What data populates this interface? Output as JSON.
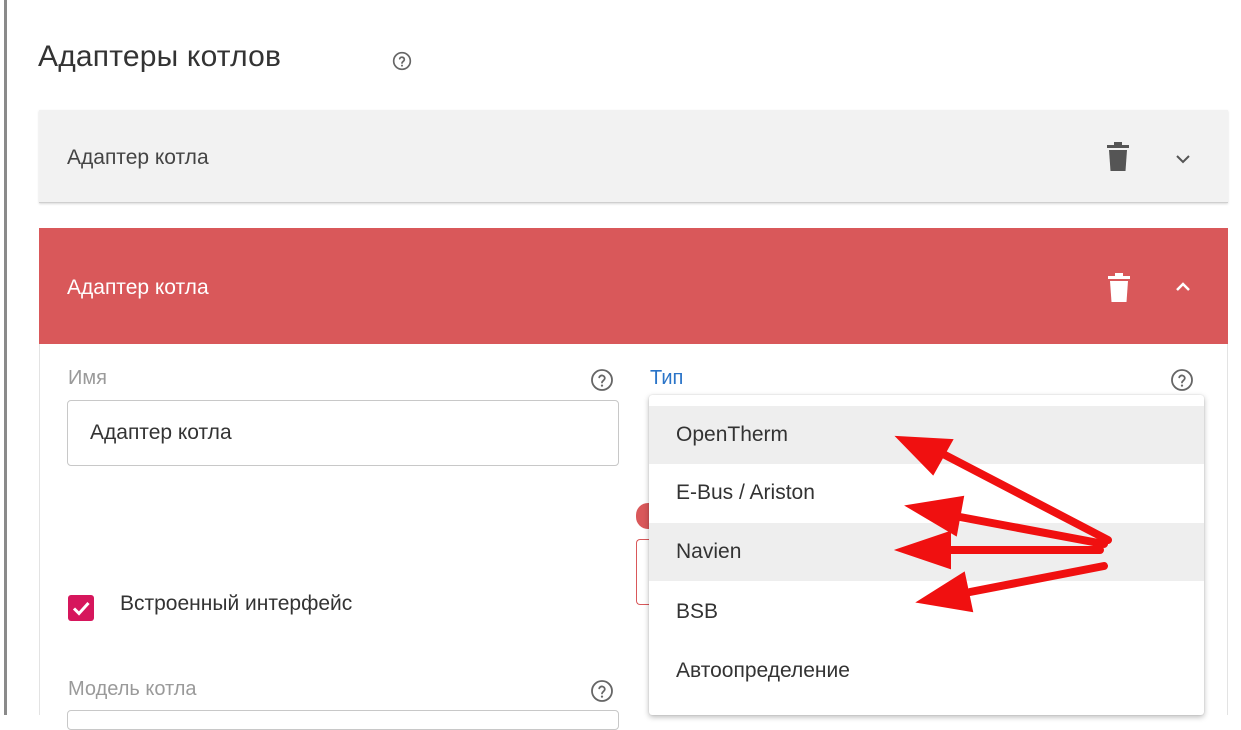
{
  "page": {
    "title": "Адаптеры котлов"
  },
  "adapters": [
    {
      "name": "Адаптер котла",
      "expanded": false
    },
    {
      "name": "Адаптер котла",
      "expanded": true
    }
  ],
  "form": {
    "name_label": "Имя",
    "name_value": "Адаптер котла",
    "type_label": "Тип",
    "builtin_interface_label": "Встроенный интерфейс",
    "builtin_interface_checked": true,
    "model_label": "Модель котла"
  },
  "type_options": [
    {
      "label": "OpenTherm",
      "highlighted": true
    },
    {
      "label": "E-Bus / Ariston",
      "highlighted": false
    },
    {
      "label": "Navien",
      "highlighted": true
    },
    {
      "label": "BSB",
      "highlighted": false
    },
    {
      "label": "Автоопределение",
      "highlighted": false
    }
  ],
  "colors": {
    "accent": "#d9585a",
    "checkbox": "#d6165c",
    "link": "#2a74c8",
    "annotation_arrow": "#f01010"
  },
  "icons": {
    "help": "help-circle-icon",
    "delete": "trash-icon",
    "expand": "chevron-down-icon",
    "collapse": "chevron-up-icon",
    "check": "check-icon"
  }
}
